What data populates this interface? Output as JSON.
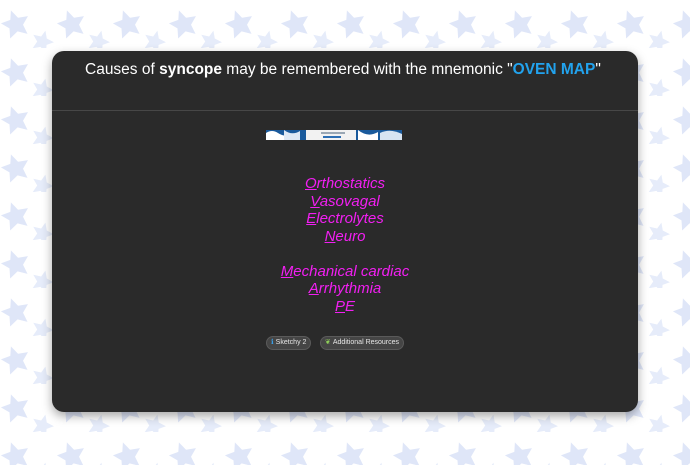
{
  "card": {
    "question_prefix": "Causes of ",
    "question_term": "syncope",
    "question_middle": " may be remembered with the mnemonic \"",
    "question_mnemonic": "OVEN MAP",
    "question_suffix": "\""
  },
  "mnemonic": {
    "group1": [
      {
        "letter": "O",
        "rest": "rthostatics"
      },
      {
        "letter": "V",
        "rest": "asovagal"
      },
      {
        "letter": "E",
        "rest": "lectrolytes"
      },
      {
        "letter": "N",
        "rest": "euro"
      }
    ],
    "group2": [
      {
        "letter": "M",
        "rest": "echanical cardiac"
      },
      {
        "letter": "A",
        "rest": "rrhythmia"
      },
      {
        "letter": "P",
        "rest": "E"
      }
    ]
  },
  "buttons": {
    "sketchy_label": "Sketchy 2",
    "sketchy_icon": "info-icon",
    "resources_label": "Additional Resources",
    "resources_icon": "leaf-icon"
  },
  "colors": {
    "mnemonic": "#f21ff2",
    "highlight": "#22a3ee",
    "card": "#2a2a2a"
  }
}
